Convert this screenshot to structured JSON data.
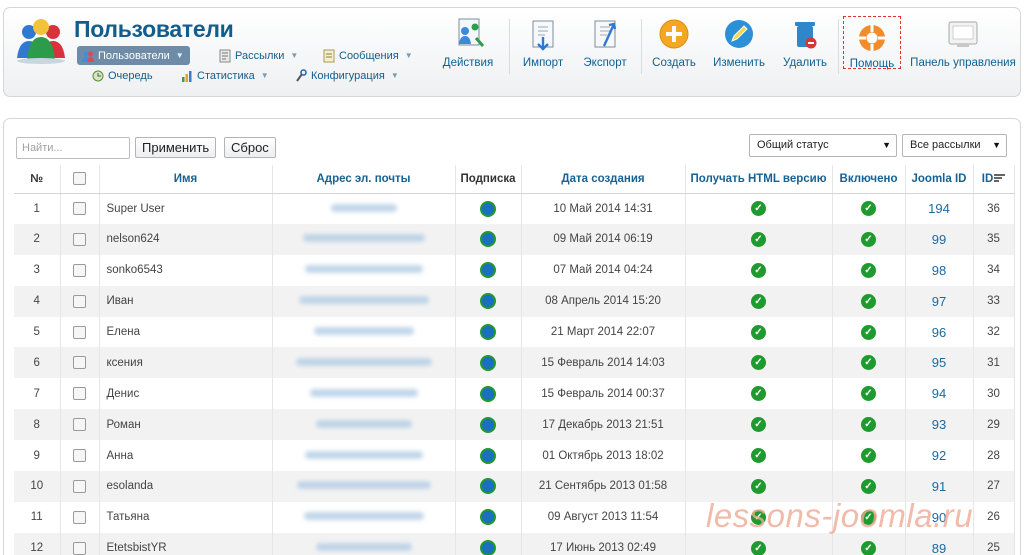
{
  "header": {
    "title": "Пользователи",
    "menu": [
      {
        "label": "Пользователи",
        "active": true,
        "icon": "users-icon"
      },
      {
        "label": "Рассылки",
        "icon": "newsletter-icon"
      },
      {
        "label": "Сообщения",
        "icon": "messages-icon"
      },
      {
        "label": "Очередь",
        "icon": "queue-icon"
      },
      {
        "label": "Статистика",
        "icon": "stats-icon"
      },
      {
        "label": "Конфигурация",
        "icon": "config-icon"
      }
    ],
    "toolbar": {
      "actions": "Действия",
      "import": "Импорт",
      "export": "Экспорт",
      "create": "Создать",
      "edit": "Изменить",
      "delete": "Удалить",
      "help": "Помощь",
      "control_panel": "Панель управления"
    }
  },
  "filters": {
    "search_placeholder": "Найти...",
    "apply": "Применить",
    "reset": "Сброс",
    "status_select": "Общий статус",
    "list_select": "Все рассылки"
  },
  "table": {
    "columns": {
      "num": "№",
      "name": "Имя",
      "email": "Адрес эл. почты",
      "subscription": "Подписка",
      "created": "Дата создания",
      "html": "Получать HTML версию",
      "enabled": "Включено",
      "joomla_id": "Joomla ID",
      "id": "ID"
    },
    "rows": [
      {
        "num": "1",
        "name": "Super User",
        "created": "10 Май 2014 14:31",
        "joomla_id": "194",
        "id": "36"
      },
      {
        "num": "2",
        "name": "nelson624",
        "created": "09 Май 2014 06:19",
        "joomla_id": "99",
        "id": "35"
      },
      {
        "num": "3",
        "name": "sonko6543",
        "created": "07 Май 2014 04:24",
        "joomla_id": "98",
        "id": "34"
      },
      {
        "num": "4",
        "name": "Иван",
        "created": "08 Апрель 2014 15:20",
        "joomla_id": "97",
        "id": "33"
      },
      {
        "num": "5",
        "name": "Елена",
        "created": "21 Март 2014 22:07",
        "joomla_id": "96",
        "id": "32"
      },
      {
        "num": "6",
        "name": "ксения",
        "created": "15 Февраль 2014 14:03",
        "joomla_id": "95",
        "id": "31"
      },
      {
        "num": "7",
        "name": "Денис",
        "created": "15 Февраль 2014 00:37",
        "joomla_id": "94",
        "id": "30"
      },
      {
        "num": "8",
        "name": "Роман",
        "created": "17 Декабрь 2013 21:51",
        "joomla_id": "93",
        "id": "29"
      },
      {
        "num": "9",
        "name": "Анна",
        "created": "01 Октябрь 2013 18:02",
        "joomla_id": "92",
        "id": "28"
      },
      {
        "num": "10",
        "name": "esolanda",
        "created": "21 Сентябрь 2013 01:58",
        "joomla_id": "91",
        "id": "27"
      },
      {
        "num": "11",
        "name": "Татьяна",
        "created": "09 Август 2013 11:54",
        "joomla_id": "90",
        "id": "26"
      },
      {
        "num": "12",
        "name": "EtetsbistYR",
        "created": "17 Июнь 2013 02:49",
        "joomla_id": "89",
        "id": "25"
      }
    ]
  },
  "watermark": "lessons-joomla.ru",
  "colors": {
    "accent": "#125d8c",
    "ok_green": "#1e9a2e",
    "subscription_blue": "#1b6fc0",
    "help_border": "#dd3333"
  }
}
